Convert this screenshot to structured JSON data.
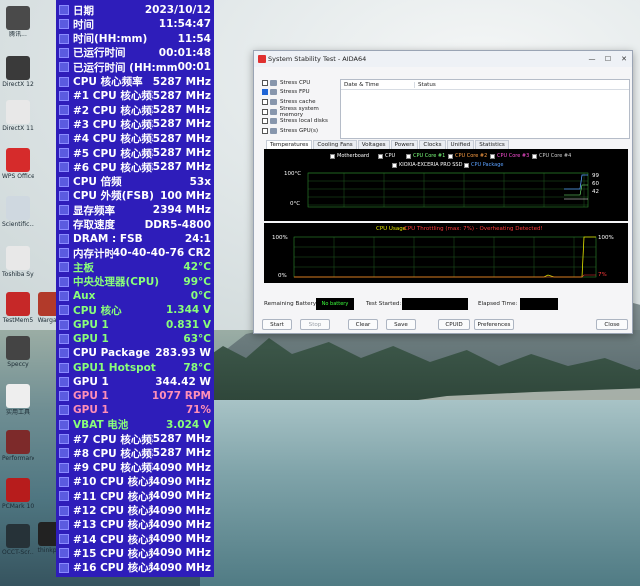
{
  "desktop": {
    "icons": [
      {
        "label": "腾讯...",
        "color": "#4a4a4a"
      },
      {
        "label": "DirectX 12",
        "color": "#3a3a3a"
      },
      {
        "label": "DirectX 11",
        "color": "#e8e8e8"
      },
      {
        "label": "WPS Office",
        "color": "#d62b2b"
      },
      {
        "label": "Scientific...",
        "color": "#cfd8e0"
      },
      {
        "label": "Toshiba System",
        "color": "#e8e8e8"
      },
      {
        "label": "TestMem5",
        "color": "#c62828"
      },
      {
        "label": "Speccy",
        "color": "#444"
      },
      {
        "label": "实用工具",
        "color": "#eeeeee"
      },
      {
        "label": "Performance",
        "color": "#7d2a2a"
      },
      {
        "label": "PCMark 10",
        "color": "#b71c1c"
      },
      {
        "label": "OCCT-Scr...",
        "color": "#263238"
      },
      {
        "label": "Warga...",
        "color": "#b23a2a"
      },
      {
        "label": "thinkp...",
        "color": "#222"
      }
    ]
  },
  "osd": {
    "rows": [
      {
        "label": "日期",
        "value": "2023/10/12",
        "color": "w"
      },
      {
        "label": "时间",
        "value": "11:54:47",
        "color": "w"
      },
      {
        "label": "时间(HH:mm)",
        "value": "11:54",
        "color": "w"
      },
      {
        "label": "已运行时间",
        "value": "00:01:48",
        "color": "w"
      },
      {
        "label": "已运行时间 (HH:mm)",
        "value": "00:01",
        "color": "w"
      },
      {
        "label": "CPU 核心频率",
        "value": "5287 MHz",
        "color": "w"
      },
      {
        "label": "#1 CPU 核心频率",
        "value": "5287 MHz",
        "color": "w"
      },
      {
        "label": "#2 CPU 核心频率",
        "value": "5287 MHz",
        "color": "w"
      },
      {
        "label": "#3 CPU 核心频率",
        "value": "5287 MHz",
        "color": "w"
      },
      {
        "label": "#4 CPU 核心频率",
        "value": "5287 MHz",
        "color": "w"
      },
      {
        "label": "#5 CPU 核心频率",
        "value": "5287 MHz",
        "color": "w"
      },
      {
        "label": "#6 CPU 核心频率",
        "value": "5287 MHz",
        "color": "w"
      },
      {
        "label": "CPU 倍频",
        "value": "53x",
        "color": "w"
      },
      {
        "label": "CPU 外频(FSB)",
        "value": "100 MHz",
        "color": "w"
      },
      {
        "label": "显存频率",
        "value": "2394 MHz",
        "color": "w"
      },
      {
        "label": "存取速度",
        "value": "DDR5-4800",
        "color": "w"
      },
      {
        "label": "DRAM : FSB",
        "value": "24:1",
        "color": "w"
      },
      {
        "label": "内存计时",
        "value": "40-40-40-76 CR2",
        "color": "w"
      },
      {
        "label": "主板",
        "value": "42°C",
        "color": "g"
      },
      {
        "label": "中央处理器(CPU)",
        "value": "99°C",
        "color": "g"
      },
      {
        "label": "Aux",
        "value": "0°C",
        "color": "g"
      },
      {
        "label": "CPU 核心",
        "value": "1.344 V",
        "color": "g"
      },
      {
        "label": "GPU 1",
        "value": "0.831 V",
        "color": "g"
      },
      {
        "label": "GPU 1",
        "value": "63°C",
        "color": "g"
      },
      {
        "label": "CPU Package",
        "value": "283.93 W",
        "color": "w"
      },
      {
        "label": "GPU1 Hotspot",
        "value": "78°C",
        "color": "g"
      },
      {
        "label": "GPU 1",
        "value": "344.42 W",
        "color": "w"
      },
      {
        "label": "GPU 1",
        "value": "1077 RPM",
        "color": "p"
      },
      {
        "label": "GPU 1",
        "value": "71%",
        "color": "p"
      },
      {
        "label": "VBAT 电池",
        "value": "3.024 V",
        "color": "g"
      },
      {
        "label": "#7 CPU 核心频率",
        "value": "5287 MHz",
        "color": "w"
      },
      {
        "label": "#8 CPU 核心频率",
        "value": "5287 MHz",
        "color": "w"
      },
      {
        "label": "#9 CPU 核心频率",
        "value": "4090 MHz",
        "color": "w"
      },
      {
        "label": "#10 CPU 核心频率",
        "value": "4090 MHz",
        "color": "w"
      },
      {
        "label": "#11 CPU 核心频率",
        "value": "4090 MHz",
        "color": "w"
      },
      {
        "label": "#12 CPU 核心频率",
        "value": "4090 MHz",
        "color": "w"
      },
      {
        "label": "#13 CPU 核心频率",
        "value": "4090 MHz",
        "color": "w"
      },
      {
        "label": "#14 CPU 核心频率",
        "value": "4090 MHz",
        "color": "w"
      },
      {
        "label": "#15 CPU 核心频率",
        "value": "4090 MHz",
        "color": "w"
      },
      {
        "label": "#16 CPU 核心频率",
        "value": "4090 MHz",
        "color": "w"
      }
    ]
  },
  "window": {
    "title": "System Stability Test - AIDA64",
    "stress_options": [
      {
        "label": "Stress CPU",
        "checked": false
      },
      {
        "label": "Stress FPU",
        "checked": true
      },
      {
        "label": "Stress cache",
        "checked": false
      },
      {
        "label": "Stress system memory",
        "checked": false
      },
      {
        "label": "Stress local disks",
        "checked": false
      },
      {
        "label": "Stress GPU(s)",
        "checked": false
      }
    ],
    "log_headers": {
      "date_time": "Date & Time",
      "status": "Status"
    },
    "tabs": [
      "Temperatures",
      "Cooling Fans",
      "Voltages",
      "Powers",
      "Clocks",
      "Unified",
      "Statistics"
    ],
    "temp_legend": [
      {
        "label": "Motherboard",
        "color": "#ffffff"
      },
      {
        "label": "CPU",
        "color": "#ffffff"
      },
      {
        "label": "CPU Core #1",
        "color": "#7cff7c"
      },
      {
        "label": "CPU Core #2",
        "color": "#ff9f43"
      },
      {
        "label": "CPU Core #3",
        "color": "#ff4fd8"
      },
      {
        "label": "CPU Core #4",
        "color": "#d0d0d0"
      },
      {
        "label": "KIOXIA-EXCERIA PRO SSD",
        "color": "#ffffff"
      },
      {
        "label": "CPU Package",
        "color": "#5aa0ff"
      }
    ],
    "temp_axis": {
      "top": "100°C",
      "bottom": "0°C"
    },
    "temp_readouts": [
      "99",
      "60",
      "42"
    ],
    "usage_title": "CPU Usage",
    "usage_warning": "CPU Throttling (max: 7%) - Overheating Detected!",
    "usage_axis": {
      "top": "100%",
      "bottom": "0%"
    },
    "usage_right": {
      "top": "100%",
      "bottom": "7%"
    },
    "fields": {
      "battery_label": "Remaining Battery:",
      "battery_value": "No battery",
      "started_label": "Test Started:",
      "elapsed_label": "Elapsed Time:"
    },
    "buttons": {
      "start": "Start",
      "stop": "Stop",
      "clear": "Clear",
      "save": "Save",
      "cpuid": "CPUID",
      "preferences": "Preferences",
      "close": "Close"
    },
    "title_buttons": {
      "minimize": "—",
      "maximize": "☐",
      "close": "✕"
    }
  }
}
